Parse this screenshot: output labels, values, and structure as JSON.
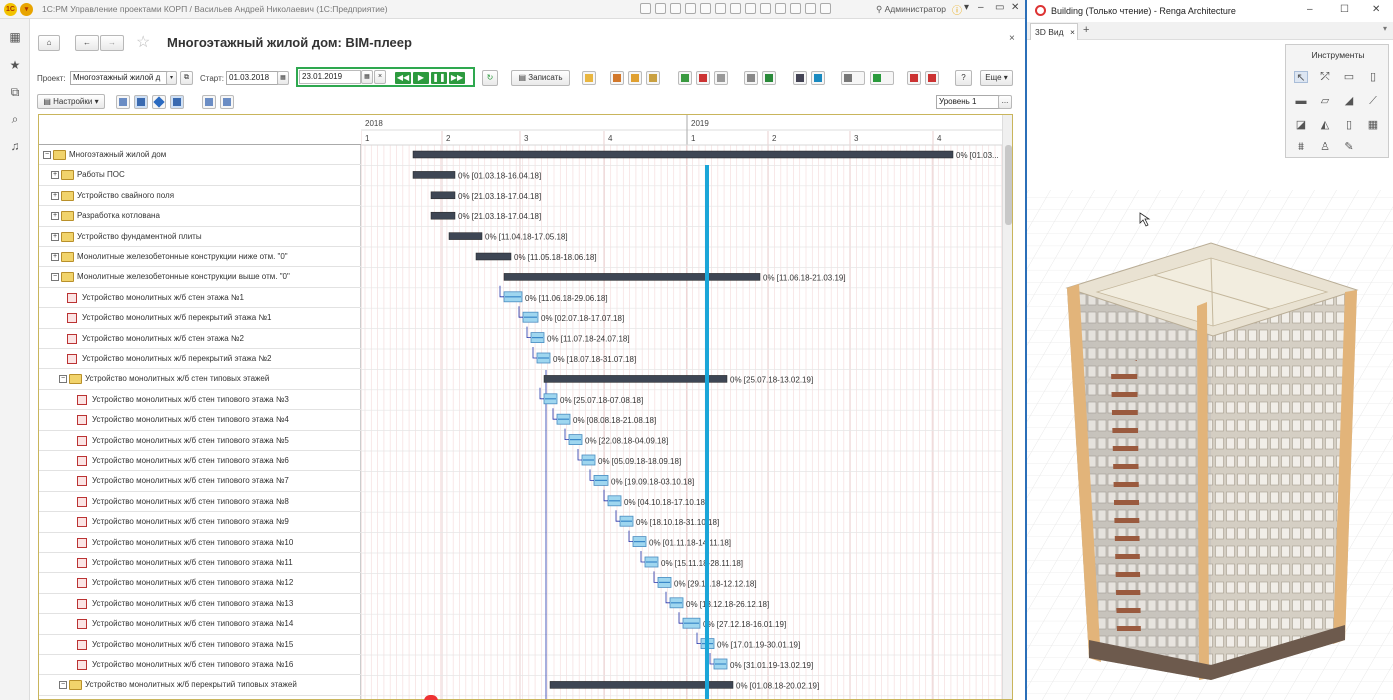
{
  "onec": {
    "window_title": "1С:РМ Управление проектами КОРП / Васильев Андрей Николаевич (1С:Предприятие)",
    "user": "Администратор",
    "form_title": "Многоэтажный жилой дом: BIM-плеер",
    "labels": {
      "project": "Проект:",
      "start": "Старт:"
    },
    "fields": {
      "project": "Многоэтажный жилой д",
      "start": "01.03.2018",
      "current_date": "23.01.2019",
      "level": "Уровень 1"
    },
    "buttons": {
      "write": "Записать",
      "more": "Еще",
      "settings": "Настройки"
    },
    "gantt": {
      "years": [
        "2018",
        "2019"
      ],
      "quarters": [
        "1",
        "2",
        "3",
        "4",
        "1",
        "2",
        "3",
        "4"
      ],
      "rows": [
        {
          "name": "Многоэтажный жилой дом",
          "label": "0% [01.03..."
        },
        {
          "name": "Работы ПОС",
          "label": "0% [01.03.18-16.04.18]"
        },
        {
          "name": "Устройство свайного поля",
          "label": "0% [21.03.18-17.04.18]"
        },
        {
          "name": "Разработка котлована",
          "label": "0% [21.03.18-17.04.18]"
        },
        {
          "name": "Устройство фундаментной плиты",
          "label": "0% [11.04.18-17.05.18]"
        },
        {
          "name": "Монолитные железобетонные конструкции ниже отм. \"0\"",
          "label": "0% [11.05.18-18.06.18]"
        },
        {
          "name": "Монолитные железобетонные конструкции выше отм. \"0\"",
          "label": "0% [11.06.18-21.03.19]"
        },
        {
          "name": "Устройство монолитных ж/б стен этажа №1",
          "label": "0% [11.06.18-29.06.18]"
        },
        {
          "name": "Устройство монолитных ж/б перекрытий этажа №1",
          "label": "0% [02.07.18-17.07.18]"
        },
        {
          "name": "Устройство монолитных ж/б стен этажа №2",
          "label": "0% [11.07.18-24.07.18]"
        },
        {
          "name": "Устройство монолитных ж/б перекрытий этажа №2",
          "label": "0% [18.07.18-31.07.18]"
        },
        {
          "name": "Устройство монолитных ж/б стен типовых этажей",
          "label": "0% [25.07.18-13.02.19]"
        },
        {
          "name": "Устройство монолитных ж/б стен типового этажа №3",
          "label": "0% [25.07.18-07.08.18]"
        },
        {
          "name": "Устройство монолитных ж/б стен типового этажа №4",
          "label": "0% [08.08.18-21.08.18]"
        },
        {
          "name": "Устройство монолитных ж/б стен типового этажа №5",
          "label": "0% [22.08.18-04.09.18]"
        },
        {
          "name": "Устройство монолитных ж/б стен типового этажа №6",
          "label": "0% [05.09.18-18.09.18]"
        },
        {
          "name": "Устройство монолитных ж/б стен типового этажа №7",
          "label": "0% [19.09.18-03.10.18]"
        },
        {
          "name": "Устройство монолитных ж/б стен типового этажа №8",
          "label": "0% [04.10.18-17.10.18]"
        },
        {
          "name": "Устройство монолитных ж/б стен типового этажа №9",
          "label": "0% [18.10.18-31.10.18]"
        },
        {
          "name": "Устройство монолитных ж/б стен типового этажа №10",
          "label": "0% [01.11.18-14.11.18]"
        },
        {
          "name": "Устройство монолитных ж/б стен типового этажа №11",
          "label": "0% [15.11.18-28.11.18]"
        },
        {
          "name": "Устройство монолитных ж/б стен типового этажа №12",
          "label": "0% [29.11.18-12.12.18]"
        },
        {
          "name": "Устройство монолитных ж/б стен типового этажа №13",
          "label": "0% [13.12.18-26.12.18]"
        },
        {
          "name": "Устройство монолитных ж/б стен типового этажа №14",
          "label": "0% [27.12.18-16.01.19]"
        },
        {
          "name": "Устройство монолитных ж/б стен типового этажа №15",
          "label": "0% [17.01.19-30.01.19]"
        },
        {
          "name": "Устройство монолитных ж/б стен типового этажа №16",
          "label": "0% [31.01.19-13.02.19]"
        },
        {
          "name": "Устройство монолитных ж/б перекрытий типовых этажей",
          "label": "0% [01.08.18-20.02.19]"
        }
      ]
    }
  },
  "renga": {
    "window_title": "Building (Только чтение) - Renga Architecture",
    "tab": "3D Вид",
    "tools_title": "Инструменты"
  }
}
